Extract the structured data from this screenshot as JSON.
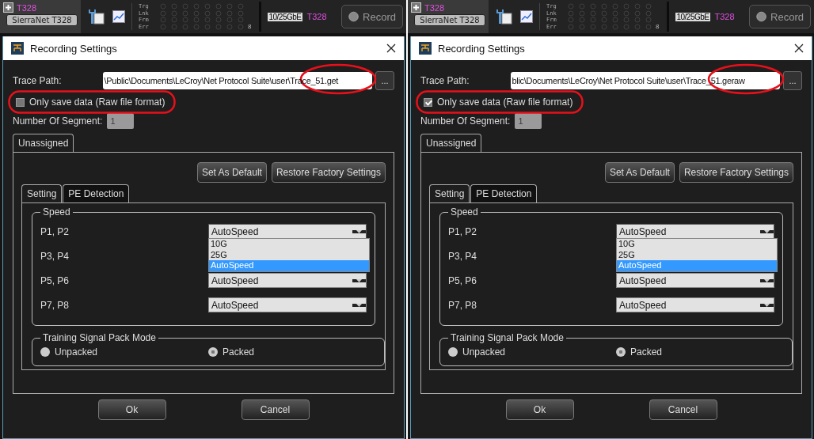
{
  "panels": [
    {
      "toolbar": {
        "device": "T328",
        "device_button": "SierraNet T328",
        "indicator_rows": [
          "Trg",
          "Lnk",
          "Frm",
          "Err"
        ],
        "count": "8",
        "link_badge": "10/25GbE",
        "link_device": "T328",
        "record_button": "Record"
      },
      "dialog": {
        "title": "Recording Settings",
        "trace_path_label": "Trace Path:",
        "trace_path": {
          "value": "\\Public\\Documents\\LeCroy\\Net Protocol Suite\\user\\Trace_51.get",
          "highlighted": true
        },
        "browse_button": "...",
        "raw_only": {
          "label": "Only save data (Raw file format)",
          "checked": false,
          "highlighted": true
        },
        "segments": {
          "label": "Number Of Segment:",
          "value": "1",
          "disabled": true
        },
        "outer_tabs": [
          {
            "label": "Unassigned",
            "selected": true
          }
        ],
        "top_buttons": [
          "Set As Default",
          "Restore Factory Settings"
        ],
        "inner_tabs": [
          {
            "label": "Setting",
            "selected": true
          },
          {
            "label": "PE Detection",
            "selected": false
          }
        ],
        "speed": {
          "title": "Speed",
          "rows": [
            {
              "label": "P1, P2",
              "value": "AutoSpeed",
              "expanded": true,
              "options": [
                {
                  "label": "10G",
                  "selected": false
                },
                {
                  "label": "25G",
                  "selected": false
                },
                {
                  "label": "AutoSpeed",
                  "selected": true
                }
              ]
            },
            {
              "label": "P3, P4"
            },
            {
              "label": "P5, P6",
              "value": "AutoSpeed"
            },
            {
              "label": "P7, P8",
              "value": "AutoSpeed"
            }
          ]
        },
        "pack_mode": {
          "title": "Training Signal Pack Mode",
          "options": [
            {
              "label": "Unpacked",
              "selected": false
            },
            {
              "label": "Packed",
              "selected": true
            }
          ]
        },
        "buttons": [
          "Ok",
          "Cancel"
        ]
      }
    },
    {
      "toolbar": {
        "device": "T328",
        "device_button": "SierraNet T328",
        "indicator_rows": [
          "Trg",
          "Lnk",
          "Frm",
          "Err"
        ],
        "count": "8",
        "link_badge": "10/25GbE",
        "link_device": "T328",
        "record_button": "Record"
      },
      "dialog": {
        "title": "Recording Settings",
        "trace_path_label": "Trace Path:",
        "trace_path": {
          "value": "blic\\Documents\\LeCroy\\Net Protocol Suite\\user\\Trace_51.geraw",
          "highlighted": true
        },
        "browse_button": "...",
        "raw_only": {
          "label": "Only save data (Raw file format)",
          "checked": true,
          "highlighted": true
        },
        "segments": {
          "label": "Number Of Segment:",
          "value": "1",
          "disabled": true
        },
        "outer_tabs": [
          {
            "label": "Unassigned",
            "selected": true
          }
        ],
        "top_buttons": [
          "Set As Default",
          "Restore Factory Settings"
        ],
        "inner_tabs": [
          {
            "label": "Setting",
            "selected": true
          },
          {
            "label": "PE Detection",
            "selected": false
          }
        ],
        "speed": {
          "title": "Speed",
          "rows": [
            {
              "label": "P1, P2",
              "value": "AutoSpeed",
              "expanded": true,
              "options": [
                {
                  "label": "10G",
                  "selected": false
                },
                {
                  "label": "25G",
                  "selected": false
                },
                {
                  "label": "AutoSpeed",
                  "selected": true
                }
              ]
            },
            {
              "label": "P3, P4"
            },
            {
              "label": "P5, P6",
              "value": "AutoSpeed"
            },
            {
              "label": "P7, P8",
              "value": "AutoSpeed"
            }
          ]
        },
        "pack_mode": {
          "title": "Training Signal Pack Mode",
          "options": [
            {
              "label": "Unpacked",
              "selected": false
            },
            {
              "label": "Packed",
              "selected": true
            }
          ]
        },
        "buttons": [
          "Ok",
          "Cancel"
        ]
      }
    }
  ]
}
